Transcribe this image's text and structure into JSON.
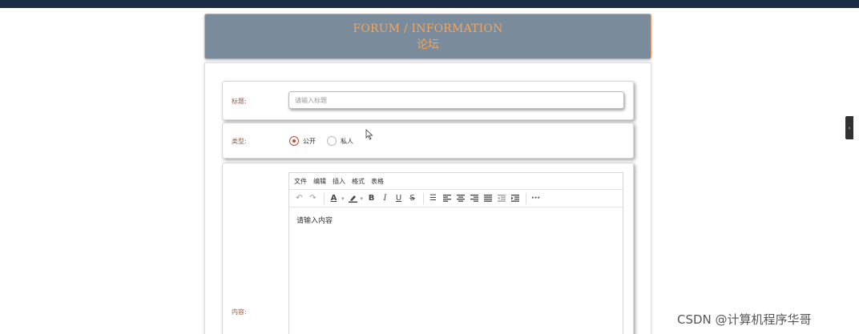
{
  "header": {
    "title_en": "FORUM / INFORMATION",
    "title_cn": "论坛"
  },
  "form": {
    "title": {
      "label": "标题:",
      "placeholder": "请输入标题",
      "value": ""
    },
    "type": {
      "label": "类型:",
      "options": [
        {
          "label": "公开",
          "checked": true
        },
        {
          "label": "私人",
          "checked": false
        }
      ]
    },
    "content": {
      "label": "内容:",
      "editor": {
        "menus": [
          "文件",
          "编辑",
          "插入",
          "格式",
          "表格"
        ],
        "toolbar": [
          "undo-icon",
          "redo-icon",
          "font-color-icon",
          "highlight-icon",
          "bold-icon",
          "italic-icon",
          "underline-icon",
          "strikethrough-icon",
          "bullet-list-icon",
          "align-left-icon",
          "align-center-icon",
          "align-right-icon",
          "align-justify-icon",
          "outdent-icon",
          "indent-icon",
          "more-icon"
        ],
        "placeholder": "请输入内容"
      }
    }
  },
  "side_tab": {
    "label": "‹"
  },
  "watermark": "CSDN @计算机程序华哥",
  "colors": {
    "topbar": "#1c2c45",
    "header_bg": "#7a8b9c",
    "header_text": "#f1a65b",
    "radio_accent": "#c44a3a",
    "label_text": "#8b5a4a"
  }
}
